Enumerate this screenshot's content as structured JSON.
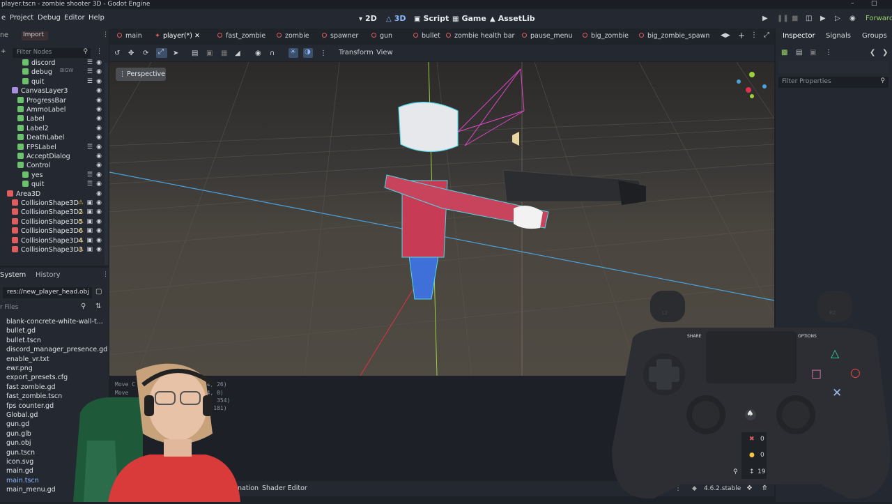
{
  "window": {
    "title": "player.tscn - zombie shooter 3D - Godot Engine",
    "min_icon": "minimize-icon",
    "max_icon": "maximize-icon"
  },
  "menu": {
    "items": [
      "Project",
      "Debug",
      "Editor",
      "Help"
    ],
    "modes": [
      {
        "label": "2D",
        "icon": "2d-icon"
      },
      {
        "label": "3D",
        "icon": "3d-icon"
      },
      {
        "label": "Script",
        "icon": "script-icon"
      },
      {
        "label": "Game",
        "icon": "game-icon"
      },
      {
        "label": "AssetLib",
        "icon": "assetlib-icon"
      }
    ],
    "renderer": "Forward"
  },
  "scene_dock": {
    "header_scene": "Scene",
    "header_import": "Import",
    "filter_placeholder": "Filter Nodes",
    "overlay_badge": "BIGW",
    "rows": [
      {
        "label": "discord",
        "indent": 32,
        "color": "#6cc26c",
        "script": true
      },
      {
        "label": "debug",
        "indent": 32,
        "color": "#6cc26c",
        "script": true
      },
      {
        "label": "quit",
        "indent": 32,
        "color": "#6cc26c",
        "script": true
      },
      {
        "label": "CanvasLayer3",
        "indent": 17,
        "color": "#a98ee0",
        "script": false
      },
      {
        "label": "ProgressBar",
        "indent": 25,
        "color": "#6cc26c",
        "script": false
      },
      {
        "label": "AmmoLabel",
        "indent": 25,
        "color": "#6cc26c",
        "script": false
      },
      {
        "label": "Label",
        "indent": 25,
        "color": "#6cc26c",
        "script": false
      },
      {
        "label": "Label2",
        "indent": 25,
        "color": "#6cc26c",
        "script": false
      },
      {
        "label": "DeathLabel",
        "indent": 25,
        "color": "#6cc26c",
        "script": false
      },
      {
        "label": "FPSLabel",
        "indent": 25,
        "color": "#6cc26c",
        "script": true
      },
      {
        "label": "AcceptDialog",
        "indent": 25,
        "color": "#6cc26c",
        "script": false
      },
      {
        "label": "Control",
        "indent": 25,
        "color": "#6cc26c",
        "script": false
      },
      {
        "label": "yes",
        "indent": 32,
        "color": "#6cc26c",
        "script": true
      },
      {
        "label": "quit",
        "indent": 32,
        "color": "#6cc26c",
        "script": true
      },
      {
        "label": "Area3D",
        "indent": 10,
        "color": "#e05d5d",
        "script": false
      },
      {
        "label": "CollisionShape3D",
        "indent": 17,
        "color": "#e05d5d",
        "script": false,
        "warn": true
      },
      {
        "label": "CollisionShape3D2",
        "indent": 17,
        "color": "#e05d5d",
        "script": false,
        "warn": true
      },
      {
        "label": "CollisionShape3D5",
        "indent": 17,
        "color": "#e05d5d",
        "script": false,
        "warn": true
      },
      {
        "label": "CollisionShape3D6",
        "indent": 17,
        "color": "#e05d5d",
        "script": false,
        "warn": true
      },
      {
        "label": "CollisionShape3D4",
        "indent": 17,
        "color": "#e05d5d",
        "script": false,
        "warn": true
      },
      {
        "label": "CollisionShape3D3",
        "indent": 17,
        "color": "#e05d5d",
        "script": false,
        "warn": true
      }
    ]
  },
  "fs_dock": {
    "tab_system": "System",
    "tab_history": "History",
    "path": "res://new_player_head.obj",
    "filter_placeholder": "r Files",
    "files": [
      "blank-concrete-white-wall-t...",
      "bullet.gd",
      "bullet.tscn",
      "discord_manager_presence.gd",
      "enable_vr.txt",
      "ewr.png",
      "export_presets.cfg",
      "fast zombie.gd",
      "fast_zombie.tscn",
      "fps counter.gd",
      "Global.gd",
      "gun.gd",
      "gun.glb",
      "gun.obj",
      "gun.tscn",
      "icon.svg",
      "main.gd",
      "main.tscn",
      "main_menu.gd"
    ]
  },
  "scene_tabs": [
    {
      "label": "main",
      "active": false
    },
    {
      "label": "player(*)",
      "active": true
    },
    {
      "label": "fast_zombie",
      "active": false
    },
    {
      "label": "zombie",
      "active": false
    },
    {
      "label": "spawner",
      "active": false
    },
    {
      "label": "gun",
      "active": false
    },
    {
      "label": "bullet",
      "active": false
    },
    {
      "label": "zombie health bar",
      "active": false
    },
    {
      "label": "pause_menu",
      "active": false
    },
    {
      "label": "big_zombie",
      "active": false
    },
    {
      "label": "big_zombie_spawn",
      "active": false
    }
  ],
  "toolbar": {
    "transform": "Transform",
    "view": "View"
  },
  "viewport": {
    "perspective": "Perspective"
  },
  "output": {
    "lines": [
      "Move C",
      "Move",
      "Move",
      "(84, 26)",
      "(94, 0)",
      "(54, 354)",
      "(5, 181)"
    ]
  },
  "bottom_tabs": {
    "animation": "nation",
    "shader_editor": "Shader Editor"
  },
  "status": {
    "version": "4.6.2.stable"
  },
  "inspector": {
    "tabs": [
      "Inspector",
      "Signals",
      "Groups"
    ],
    "filter_placeholder": "Filter Properties"
  },
  "controller": {
    "share": "SHARE",
    "options": "OPTIONS",
    "l2": "L2",
    "r2": "R2",
    "counters": [
      "0",
      "0",
      "19"
    ]
  },
  "colors": {
    "accent": "#8bb8ff",
    "node_green": "#6cc26c",
    "node_red": "#e05d5d",
    "warn": "#f5c542"
  }
}
